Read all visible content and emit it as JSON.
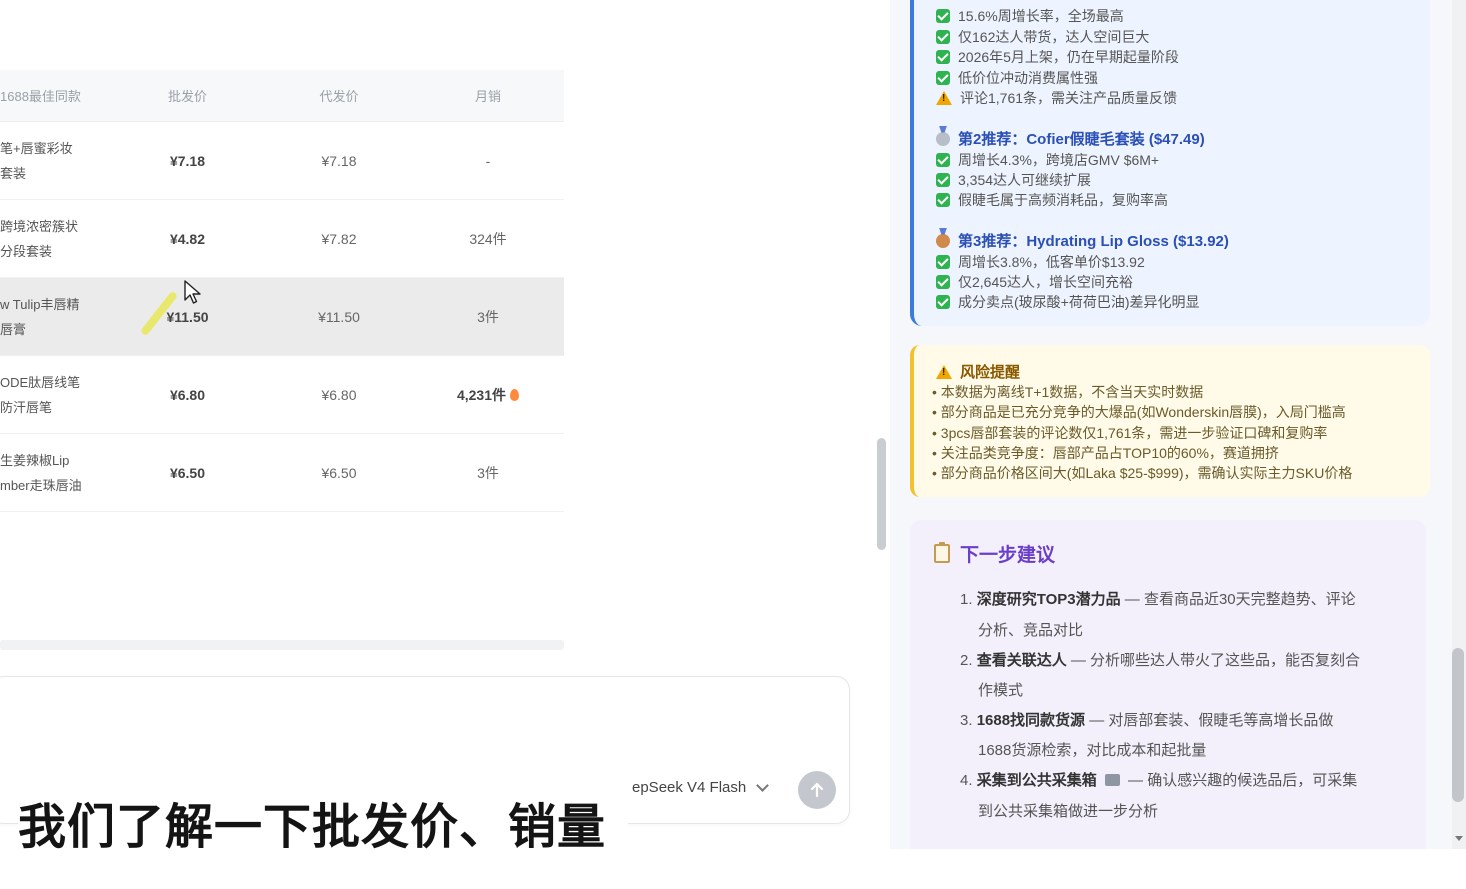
{
  "table": {
    "headers": [
      "1688最佳同款",
      "批发价",
      "代发价",
      "月销"
    ],
    "rows": [
      {
        "name_line1": "笔+唇蜜彩妆",
        "name_line2": "套装",
        "wholesale": "¥7.18",
        "dropship": "¥7.18",
        "monthly": "-"
      },
      {
        "name_line1": "跨境浓密簇状",
        "name_line2": "分段套装",
        "wholesale": "¥4.82",
        "dropship": "¥7.82",
        "monthly": "324件"
      },
      {
        "name_line1": "w Tulip丰唇精",
        "name_line2": "唇膏",
        "wholesale": "¥11.50",
        "dropship": "¥11.50",
        "monthly": "3件"
      },
      {
        "name_line1": "ODE肽唇线笔",
        "name_line2": "防汗唇笔",
        "wholesale": "¥6.80",
        "dropship": "¥6.80",
        "monthly": "4,231件"
      },
      {
        "name_line1": "生姜辣椒Lip",
        "name_line2": "mber走珠唇油",
        "wholesale": "¥6.50",
        "dropship": "¥6.50",
        "monthly": "3件"
      }
    ]
  },
  "composer": {
    "model": "epSeek V4 Flash"
  },
  "subtitle": "我们了解一下批发价、销量",
  "recommendations": {
    "first_points": [
      "15.6%周增长率，全场最高",
      "仅162达人带货，达人空间巨大",
      "2026年5月上架，仍在早期起量阶段",
      "低价位冲动消费属性强"
    ],
    "first_warning": "评论1,761条，需关注产品质量反馈",
    "second_title": "第2推荐：Cofier假睫毛套装 ($47.49)",
    "second_points": [
      "周增长4.3%，跨境店GMV $6M+",
      "3,354达人可继续扩展",
      "假睫毛属于高频消耗品，复购率高"
    ],
    "third_title": "第3推荐：Hydrating Lip Gloss ($13.92)",
    "third_points": [
      "周增长3.8%，低客单价$13.92",
      "仅2,645达人，增长空间充裕",
      "成分卖点(玻尿酸+荷荷巴油)差异化明显"
    ]
  },
  "risk": {
    "title": "风险提醒",
    "items": [
      "本数据为离线T+1数据，不含当天实时数据",
      "部分商品是已充分竞争的大爆品(如Wonderskin唇膜)，入局门槛高",
      "3pcs唇部套装的评论数仅1,761条，需进一步验证口碑和复购率",
      "关注品类竞争度：唇部产品占TOP10的60%，赛道拥挤",
      "部分商品价格区间大(如Laka $25-$999)，需确认实际主力SKU价格"
    ]
  },
  "next_steps": {
    "title": "下一步建议",
    "items": [
      {
        "num": "1.",
        "bold": "深度研究TOP3潜力品",
        "text": " — 查看商品近30天完整趋势、评论",
        "cont": "分析、竞品对比"
      },
      {
        "num": "2.",
        "bold": "查看关联达人",
        "text": " — 分析哪些达人带火了这些品，能否复刻合",
        "cont": "作模式"
      },
      {
        "num": "3.",
        "bold": "1688找同款货源",
        "text": " — 对唇部套装、假睫毛等高增长品做",
        "cont": "1688货源检索，对比成本和起批量"
      },
      {
        "num": "4.",
        "bold": "采集到公共采集箱",
        "text": " — 确认感兴趣的候选品后，可采集",
        "cont": "到公共采集箱做进一步分析"
      }
    ]
  },
  "colors": {
    "accent_blue": "#3b7be0",
    "check_green": "#2fb350",
    "warning_yellow": "#f2c12e",
    "next_purple": "#6a3fc8"
  },
  "icons": {
    "check": "check-icon",
    "warning": "warning-icon",
    "silver_medal": "silver-medal-icon",
    "bronze_medal": "bronze-medal-icon",
    "clipboard": "clipboard-icon",
    "box": "box-icon",
    "fire": "fire-icon",
    "send": "send-icon",
    "cursor": "cursor-icon"
  }
}
